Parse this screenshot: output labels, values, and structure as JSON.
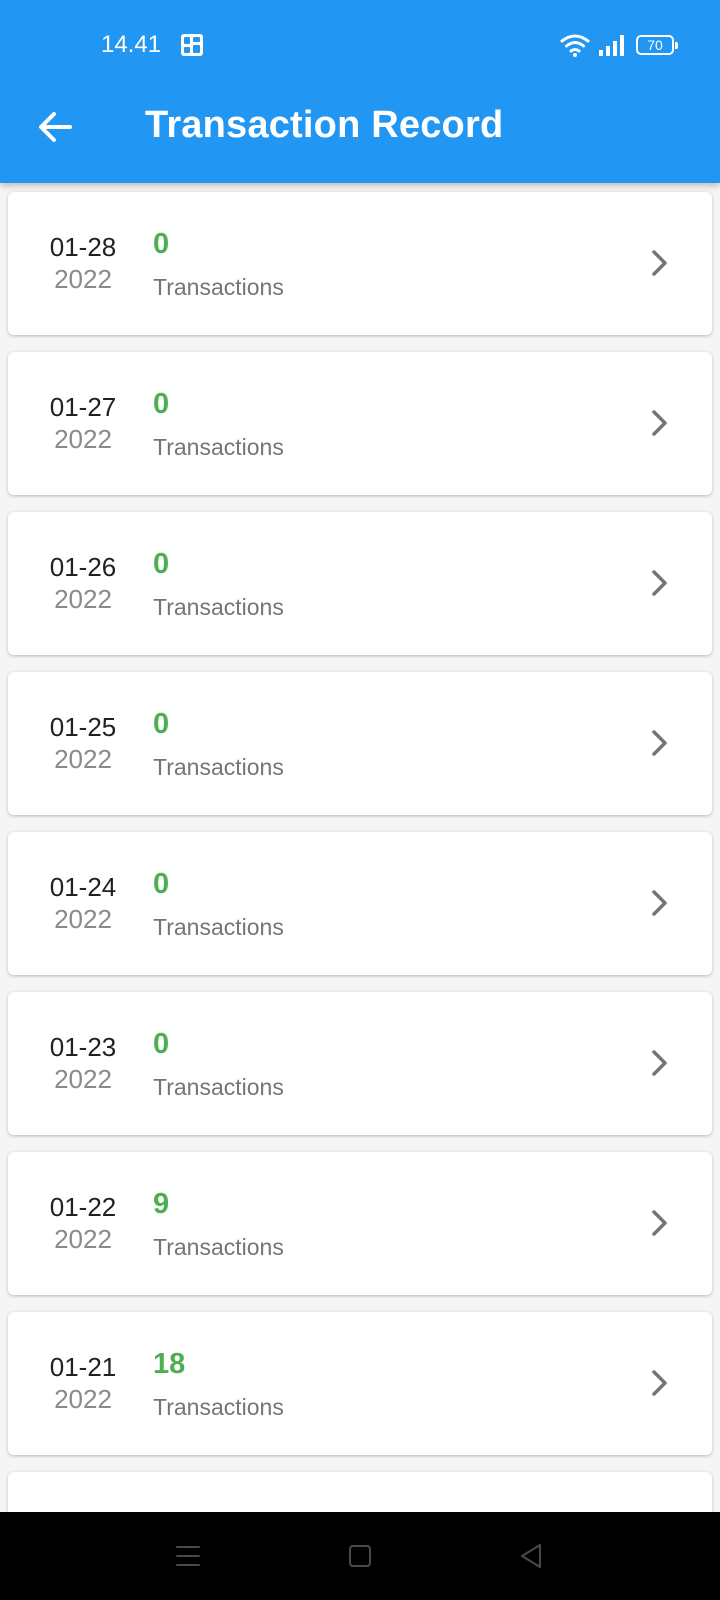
{
  "status_bar": {
    "time": "14.41",
    "battery": "70"
  },
  "app_bar": {
    "title": "Transaction Record",
    "back_icon": "arrow-left-icon"
  },
  "records": [
    {
      "date": "01-28",
      "year": "2022",
      "count": "0",
      "label": "Transactions"
    },
    {
      "date": "01-27",
      "year": "2022",
      "count": "0",
      "label": "Transactions"
    },
    {
      "date": "01-26",
      "year": "2022",
      "count": "0",
      "label": "Transactions"
    },
    {
      "date": "01-25",
      "year": "2022",
      "count": "0",
      "label": "Transactions"
    },
    {
      "date": "01-24",
      "year": "2022",
      "count": "0",
      "label": "Transactions"
    },
    {
      "date": "01-23",
      "year": "2022",
      "count": "0",
      "label": "Transactions"
    },
    {
      "date": "01-22",
      "year": "2022",
      "count": "9",
      "label": "Transactions"
    },
    {
      "date": "01-21",
      "year": "2022",
      "count": "18",
      "label": "Transactions"
    }
  ],
  "colors": {
    "primary": "#2196f3",
    "count": "#4caf50",
    "background": "#f5f5f5"
  },
  "nav_icons": [
    "menu-icon",
    "home-icon",
    "back-triangle-icon"
  ]
}
